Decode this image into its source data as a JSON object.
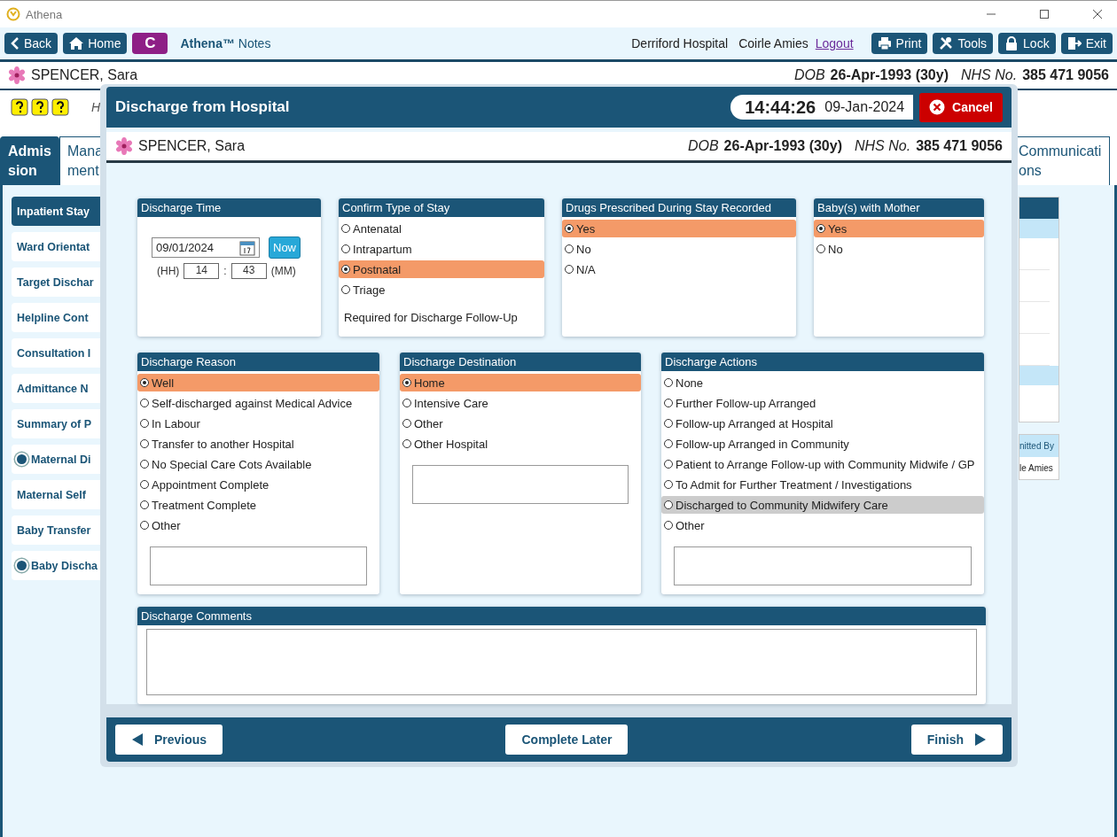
{
  "window": {
    "title": "Athena"
  },
  "toolbar": {
    "back": "Back",
    "home": "Home",
    "c_button": "C",
    "app_name": "**Athena™** Notes",
    "hospital": "Derriford Hospital",
    "user": "Coirle Amies",
    "logout": "Logout",
    "buttons": [
      "Print",
      "Tools",
      "Lock",
      "Exit"
    ]
  },
  "patient": {
    "name": "SPENCER, Sara",
    "dob_label": "DOB",
    "dob": "26-Apr-1993 (30y)",
    "nhs_label": "NHS No.",
    "nhs": "385 471 9056"
  },
  "icon_row": {
    "text": "H"
  },
  "tabs": [
    {
      "label": "Admission",
      "selected": true
    },
    {
      "label": "Mana ment",
      "selected": false
    },
    {
      "label": "Communications",
      "selected": false
    }
  ],
  "sidebar": {
    "items": [
      {
        "label": "Inpatient Stay",
        "selected": true,
        "marked": false
      },
      {
        "label": "Ward Orientat",
        "selected": false,
        "marked": false
      },
      {
        "label": "Target Dischar",
        "selected": false,
        "marked": false
      },
      {
        "label": "Helpline Cont",
        "selected": false,
        "marked": false
      },
      {
        "label": "Consultation I",
        "selected": false,
        "marked": false
      },
      {
        "label": "Admittance N",
        "selected": false,
        "marked": false
      },
      {
        "label": "Summary of P",
        "selected": false,
        "marked": false
      },
      {
        "label": "Maternal Di",
        "selected": false,
        "marked": true
      },
      {
        "label": "Maternal Self",
        "selected": false,
        "marked": false
      },
      {
        "label": "Baby Transfer",
        "selected": false,
        "marked": false
      },
      {
        "label": "Baby Discha",
        "selected": false,
        "marked": true
      }
    ]
  },
  "right_panel": {
    "header": "nitted By",
    "cell": "le Amies"
  },
  "dialog": {
    "title": "Discharge from Hospital",
    "time": "14:44:26",
    "date": "09-Jan-2024",
    "cancel": "Cancel",
    "patient": {
      "name": "SPENCER, Sara",
      "dob_label": "DOB",
      "dob": "26-Apr-1993 (30y)",
      "nhs_label": "NHS No.",
      "nhs": "385 471 9056"
    },
    "discharge_time": {
      "title": "Discharge Time",
      "date": "09/01/2024",
      "now": "Now",
      "hh_label": "(HH)",
      "hh": "14",
      "sep": ":",
      "mm": "43",
      "mm_label": "(MM)"
    },
    "type_of_stay": {
      "title": "Confirm Type of Stay",
      "note": "Required for Discharge Follow-Up",
      "options": [
        {
          "label": "Antenatal",
          "selected": false
        },
        {
          "label": "Intrapartum",
          "selected": false
        },
        {
          "label": "Postnatal",
          "selected": true
        },
        {
          "label": "Triage",
          "selected": false
        }
      ]
    },
    "drugs_recorded": {
      "title": "Drugs Prescribed During Stay Recorded",
      "options": [
        {
          "label": "Yes",
          "selected": true
        },
        {
          "label": "No",
          "selected": false
        },
        {
          "label": "N/A",
          "selected": false
        }
      ]
    },
    "babies_with_mother": {
      "title": "Baby(s) with Mother",
      "options": [
        {
          "label": "Yes",
          "selected": true
        },
        {
          "label": "No",
          "selected": false
        }
      ]
    },
    "discharge_reason": {
      "title": "Discharge Reason",
      "options": [
        {
          "label": "Well",
          "selected": true
        },
        {
          "label": "Self-discharged against Medical Advice",
          "selected": false
        },
        {
          "label": "In Labour",
          "selected": false
        },
        {
          "label": "Transfer to another Hospital",
          "selected": false
        },
        {
          "label": "No Special Care Cots Available",
          "selected": false
        },
        {
          "label": "Appointment Complete",
          "selected": false
        },
        {
          "label": "Treatment Complete",
          "selected": false
        },
        {
          "label": "Other",
          "selected": false
        }
      ]
    },
    "discharge_destination": {
      "title": "Discharge Destination",
      "options": [
        {
          "label": "Home",
          "selected": true
        },
        {
          "label": "Intensive Care",
          "selected": false
        },
        {
          "label": "Other",
          "selected": false
        },
        {
          "label": "Other Hospital",
          "selected": false
        }
      ]
    },
    "discharge_actions": {
      "title": "Discharge Actions",
      "options": [
        {
          "label": "None",
          "selected": false,
          "hovered": false
        },
        {
          "label": "Further Follow-up Arranged",
          "selected": false,
          "hovered": false
        },
        {
          "label": "Follow-up Arranged at Hospital",
          "selected": false,
          "hovered": false
        },
        {
          "label": "Follow-up Arranged in Community",
          "selected": false,
          "hovered": false
        },
        {
          "label": "Patient to Arrange Follow-up with Community Midwife / GP",
          "selected": false,
          "hovered": false
        },
        {
          "label": "To Admit for Further Treatment / Investigations",
          "selected": false,
          "hovered": false
        },
        {
          "label": "Discharged to Community Midwifery Care",
          "selected": false,
          "hovered": true
        },
        {
          "label": "Other",
          "selected": false,
          "hovered": false
        }
      ]
    },
    "comments": {
      "title": "Discharge Comments"
    },
    "footer": {
      "previous": "Previous",
      "complete_later": "Complete Later",
      "finish": "Finish"
    }
  }
}
